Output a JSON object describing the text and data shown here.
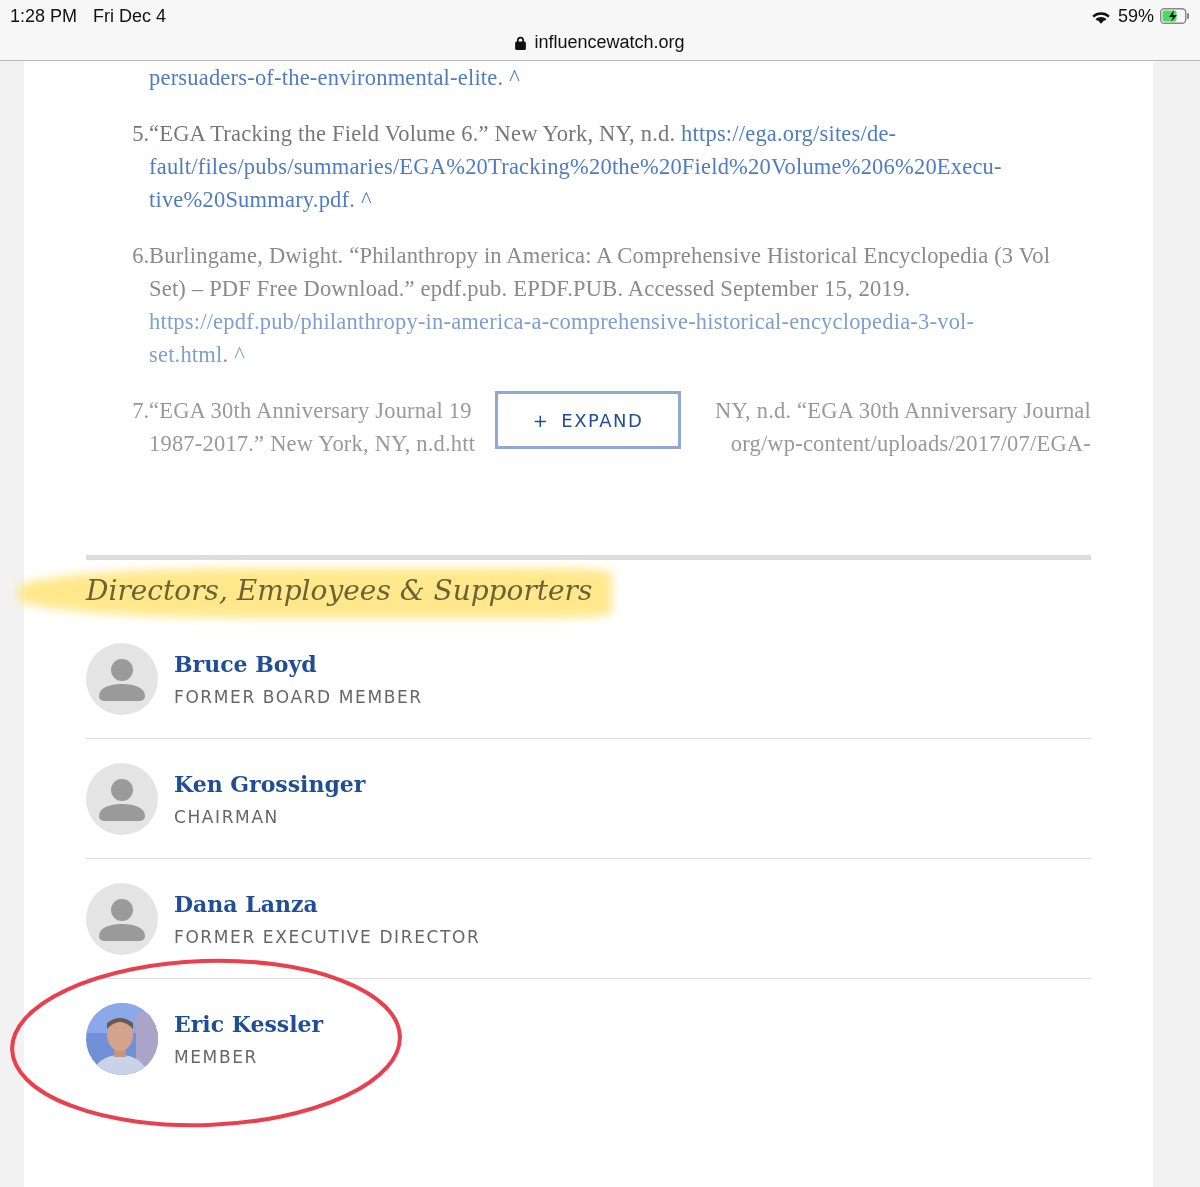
{
  "status_bar": {
    "time": "1:28 PM",
    "date": "Fri Dec 4",
    "battery": "59%",
    "url": "influencewatch.org"
  },
  "references": [
    {
      "covered": false,
      "lines": [
        [
          {
            "kind": "link",
            "text": "persuaders-of-the-environmental-elite"
          },
          {
            "kind": "text",
            "text": ". "
          },
          {
            "kind": "link",
            "text": "^"
          }
        ]
      ]
    },
    {
      "number": "5.",
      "covered": false,
      "lines": [
        [
          {
            "kind": "text",
            "text": "“EGA Tracking the Field Volume 6.” New York, NY, n.d. "
          },
          {
            "kind": "link",
            "text": "https://ega.org/sites/de-"
          }
        ],
        [
          {
            "kind": "link",
            "text": "fault/files/pubs/summaries/EGA%20Tracking%20the%20Field%20Volume%206%20Execu-"
          }
        ],
        [
          {
            "kind": "link",
            "text": "tive%20Summary.pdf"
          },
          {
            "kind": "text",
            "text": ". "
          },
          {
            "kind": "link",
            "text": "^"
          }
        ]
      ]
    },
    {
      "number": "6.",
      "covered": false,
      "lines": [
        [
          {
            "kind": "text",
            "text": "Burlingame, Dwight. “Philanthropy in America: A Comprehensive Historical Encyclopedia (3 Vol"
          }
        ],
        [
          {
            "kind": "text",
            "text": "Set) – PDF Free Download.” epdf.pub. EPDF.PUB. Accessed September 15, 2019."
          }
        ],
        [
          {
            "kind": "link",
            "text": "https://epdf.pub/philanthropy-in-america-a-comprehensive-historical-encyclopedia-3-vol-"
          }
        ],
        [
          {
            "kind": "link",
            "text": "set.html"
          },
          {
            "kind": "text",
            "text": ". "
          },
          {
            "kind": "link",
            "text": "^"
          }
        ]
      ]
    },
    {
      "number": "7.",
      "covered": true,
      "lines": [
        [
          {
            "kind": "text",
            "text": "“EGA 30th Anniversary Journal 19"
          },
          {
            "kind": "text",
            "text": "NY, n.d. “EGA 30th Anniversary Journal"
          }
        ],
        [
          {
            "kind": "text",
            "text": "1987-2017.” New York, NY, n.d.htt"
          },
          {
            "kind": "text",
            "text": "org/wp-content/uploads/2017/07/EGA-"
          }
        ]
      ]
    }
  ],
  "expand_button": {
    "icon": "+",
    "label": "EXPAND"
  },
  "section": {
    "heading": "Directors, Employees & Supporters",
    "highlighted": true
  },
  "people": [
    {
      "kind": "placeholder",
      "name": "Bruce Boyd",
      "role": "FORMER BOARD MEMBER",
      "circled": false
    },
    {
      "kind": "placeholder",
      "name": "Ken Grossinger",
      "role": "CHAIRMAN",
      "circled": false
    },
    {
      "kind": "placeholder",
      "name": "Dana Lanza",
      "role": "FORMER EXECUTIVE DIRECTOR",
      "circled": false
    },
    {
      "kind": "picture",
      "name": "Eric Kessler",
      "role": "MEMBER",
      "circled": true
    }
  ]
}
